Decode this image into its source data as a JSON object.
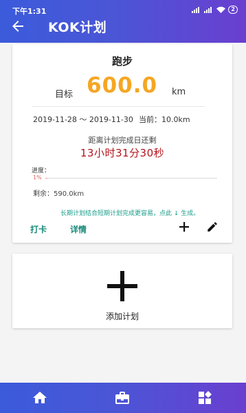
{
  "status": {
    "time": "下午1:31",
    "signal_text": "HD",
    "battery_level": "2"
  },
  "header": {
    "title": "KOK计划"
  },
  "plan_card": {
    "title": "跑步",
    "goal_label": "目标",
    "goal_value": "600.0",
    "goal_unit": "km",
    "date_range": "2019-11-28 ～ 2019-11-30",
    "current": "当前：10.0km",
    "remaining_label": "距离计划完成日还剩",
    "countdown": "13小时31分30秒",
    "progress_label": "进度：",
    "progress_percent_text": "1%",
    "progress_fraction": 0.01,
    "remaining_amount": "剩余：590.0km",
    "hint": "长期计划结合短期计划完成更容易，点此 ↓ 生成。",
    "checkin_label": "打卡",
    "detail_label": "详情",
    "add_icon": "plus-icon",
    "edit_icon": "pencil-icon"
  },
  "add_card": {
    "label": "添加计划",
    "icon": "plus-icon"
  },
  "bottom_nav": {
    "items": [
      {
        "icon": "home-icon"
      },
      {
        "icon": "briefcase-icon"
      },
      {
        "icon": "dashboard-icon"
      }
    ]
  },
  "colors": {
    "header_gradient_start": "#3b5bdb",
    "header_gradient_end": "#6a3fd0",
    "goal_value": "#f5a623",
    "countdown": "#b4121b",
    "accent_teal": "#1a8a7a"
  }
}
